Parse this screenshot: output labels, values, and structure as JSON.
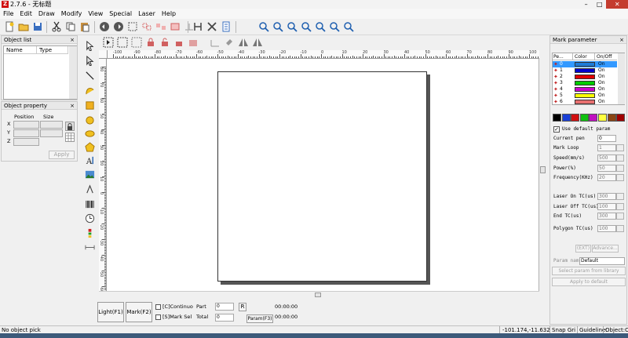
{
  "window": {
    "title": "2.7.6 - 无标题",
    "app_icon": "app-logo-icon",
    "controls": [
      "–",
      "□",
      "✕"
    ]
  },
  "menu": [
    "File",
    "Edit",
    "Draw",
    "Modify",
    "View",
    "Special",
    "Laser",
    "Help"
  ],
  "object_list": {
    "title": "Object list",
    "close": "×",
    "col_name": "Name",
    "col_type": "Type"
  },
  "object_property": {
    "title": "Object property",
    "close": "×",
    "position": "Position",
    "size": "Size",
    "x": "X",
    "y": "Y",
    "z": "Z",
    "apply": "Apply"
  },
  "ruler": {
    "top_ticks": [
      "-100",
      "-90",
      "-80",
      "-70",
      "-60",
      "-50",
      "-40",
      "-30",
      "-20",
      "-10",
      "0",
      "10",
      "20",
      "30",
      "40",
      "50",
      "60",
      "70",
      "80",
      "90",
      "100"
    ],
    "left_ticks": [
      "80",
      "70",
      "60",
      "50",
      "40",
      "30",
      "20",
      "10",
      "0",
      "-10",
      "-20",
      "-30",
      "-40",
      "-50",
      "-60"
    ]
  },
  "bottom": {
    "light": "Light(F1)",
    "mark": "Mark(F2)",
    "continuous": "[C]Continuo",
    "mark_sel": "[S]Mark Sel",
    "part_label": "Part",
    "part_value": "0",
    "total_label": "Total",
    "total_value": "0",
    "r_button": "R",
    "param_button": "Param(F3)",
    "time1": "00:00:00",
    "time2": "00:00:00"
  },
  "mark_parameter": {
    "title": "Mark parameter",
    "close": "×",
    "cols": [
      "Pe...",
      "Color",
      "On/Off"
    ],
    "pens": [
      {
        "n": "0",
        "color": "#1e7cd8",
        "on": "On"
      },
      {
        "n": "1",
        "color": "#0000cc",
        "on": "On"
      },
      {
        "n": "2",
        "color": "#e00000",
        "on": "On"
      },
      {
        "n": "3",
        "color": "#00cc00",
        "on": "On"
      },
      {
        "n": "4",
        "color": "#cc00cc",
        "on": "On"
      },
      {
        "n": "5",
        "color": "#ffff00",
        "on": "On"
      },
      {
        "n": "6",
        "color": "#e87070",
        "on": "On"
      }
    ],
    "palette": [
      "#000000",
      "#1a3fd6",
      "#d01010",
      "#10c010",
      "#c010c0",
      "#ffff40",
      "#8b4513",
      "#a00000"
    ],
    "use_default": "Use default param",
    "params": [
      {
        "label": "Current pen",
        "value": "0"
      },
      {
        "label": "Mark Loop",
        "value": "1"
      },
      {
        "label": "Speed(mm/s)",
        "value": "500"
      },
      {
        "label": "Power(%)",
        "value": "50"
      },
      {
        "label": "Frequency(KHz)",
        "value": "20"
      },
      {
        "label": "Laser On TC(us)",
        "value": "300"
      },
      {
        "label": "Laser Off TC(us)",
        "value": "100"
      },
      {
        "label": "End TC(us)",
        "value": "300"
      },
      {
        "label": "Polygon TC(us)",
        "value": "100"
      }
    ],
    "ext_button": "(EXT)",
    "advance_button": "Advance...",
    "param_name_label": "Param name",
    "param_name_value": "Default",
    "select_library": "Select param from library",
    "apply_default": "Apply to default"
  },
  "status": {
    "message": "No object pick",
    "coords": "-101.174,-11.632",
    "snap": "Snap Gri",
    "guideline": "Guideline:",
    "object": "Object:O"
  }
}
